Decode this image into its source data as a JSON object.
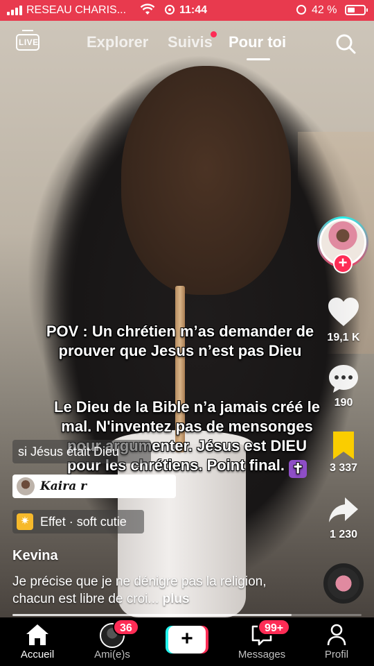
{
  "status_bar": {
    "carrier": "RESEAU CHARIS...",
    "time": "11:44",
    "battery": "42 %",
    "background": "#e83a4e"
  },
  "top_nav": {
    "live_label": "LIVE",
    "tabs": [
      {
        "label": "Explorer",
        "active": false
      },
      {
        "label": "Suivis",
        "active": false,
        "has_dot": true
      },
      {
        "label": "Pour toi",
        "active": true
      }
    ]
  },
  "actions": {
    "likes": "19,1 K",
    "comments": "190",
    "saves": "3 337",
    "shares": "1 230"
  },
  "captions": {
    "line1": "POV : Un chrétien m’as demander de prouver que Jesus n’est pas Dieu",
    "line2": "Le Dieu de la Bible n’a jamais créé le mal. N'inventez pas de mensonges pour argumenter. Jésus est DIEU pour les chrétiens. Point final."
  },
  "chips": {
    "search": "si Jésus était Dieu",
    "kaira": "Kaira r",
    "effect": "Effet · soft cutie"
  },
  "post": {
    "username": "Kevina",
    "description": "Je précise que je ne dénigre pas la religion, chacun est libre de croi...",
    "more": "plus",
    "progress": 0.8
  },
  "bottom_nav": {
    "home": "Accueil",
    "friends": "Ami(e)s",
    "friends_badge": "36",
    "messages": "Messages",
    "messages_badge": "99+",
    "profile": "Profil"
  },
  "colors": {
    "accent_pink": "#fe2c55",
    "accent_cyan": "#25f4ee",
    "save_yellow": "#facd00"
  },
  "icons": [
    "live-icon",
    "search-icon",
    "heart-icon",
    "comment-icon",
    "bookmark-icon",
    "share-icon",
    "home-icon",
    "messages-icon",
    "profile-icon",
    "plus-icon"
  ]
}
